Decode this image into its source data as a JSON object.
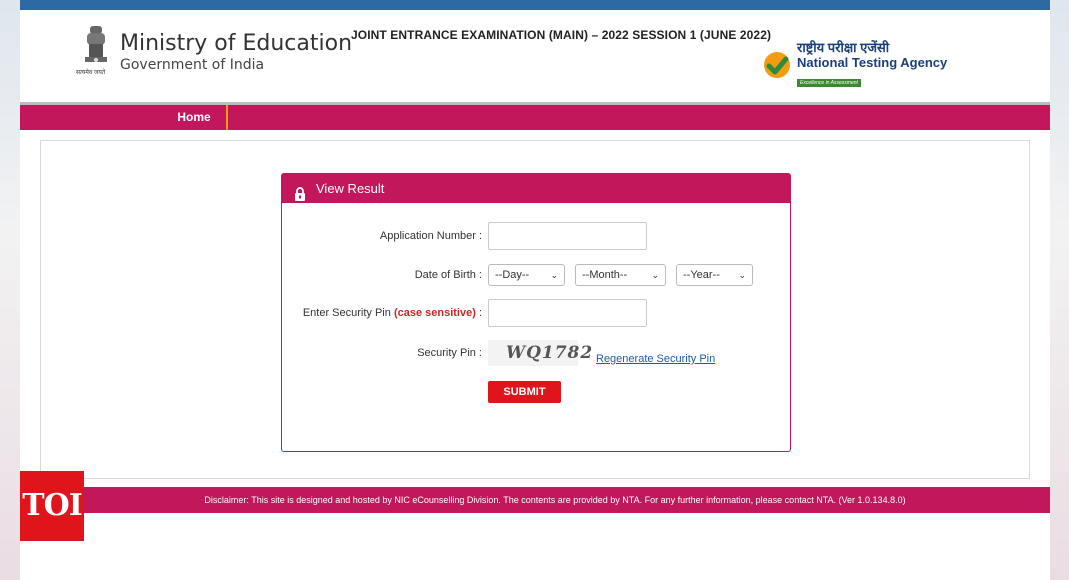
{
  "header": {
    "ministry_title": "Ministry of Education",
    "ministry_sub": "Government of India",
    "emblem_motto": "सत्यमेव जयते",
    "exam_title": "JOINT ENTRANCE EXAMINATION (MAIN) – 2022 SESSION 1 (JUNE 2022)",
    "nta_hindi": "राष्ट्रीय परीक्षा एजेंसी",
    "nta_english": "National Testing Agency",
    "nta_tagline": "Excellence in Assessment"
  },
  "nav": {
    "home_label": "Home"
  },
  "panel": {
    "title": "View Result",
    "application_number_label": "Application Number :",
    "application_number_value": "",
    "dob_label": "Date of Birth :",
    "dob_day": "--Day--",
    "dob_month": "--Month--",
    "dob_year": "--Year--",
    "security_pin_entry_label": "Enter Security Pin",
    "security_pin_entry_note": "(case sensitive)",
    "security_pin_entry_colon": ":",
    "security_pin_value": "",
    "security_pin_label": "Security Pin :",
    "captcha_text": "WQ1782",
    "regenerate_label": "Regenerate Security Pin",
    "submit_label": "SUBMIT"
  },
  "footer": {
    "disclaimer": "Disclaimer: This site is designed and hosted by NIC eCounselling Division. The contents are provided by NTA. For any further information, please contact NTA. (Ver 1.0.134.8.0)"
  },
  "watermark": {
    "label": "TOI"
  },
  "colors": {
    "brand": "#c2185b",
    "submit": "#e0141b",
    "link": "#1a5fa8",
    "top_strip": "#2d6aa3"
  }
}
